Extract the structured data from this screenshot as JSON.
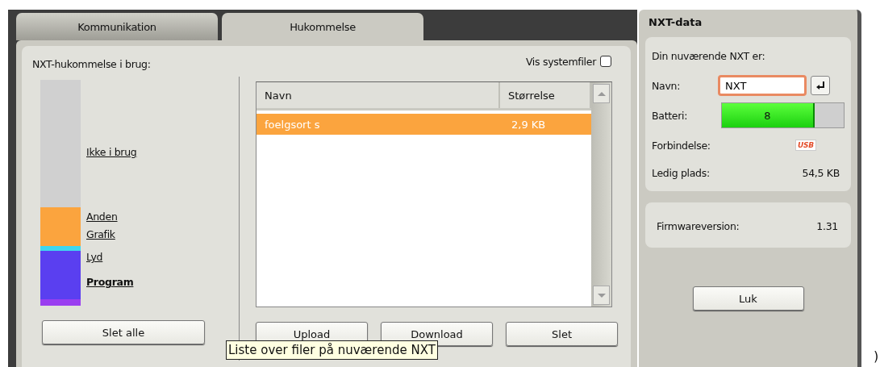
{
  "tabs": [
    {
      "label": "Kommunikation",
      "selected": false
    },
    {
      "label": "Hukommelse",
      "selected": true
    }
  ],
  "memory": {
    "title": "NXT-hukommelse i brug:",
    "segments": [
      {
        "label": "Ikke i brug",
        "color": "#d0d0d0",
        "selected": false
      },
      {
        "label": "Anden",
        "color": "#fba43e",
        "selected": false
      },
      {
        "label": "Grafik",
        "color": "#3fd6ee",
        "selected": false
      },
      {
        "label": "Lyd",
        "color": "#5a3ff0",
        "selected": false
      },
      {
        "label": "Program",
        "color": "#9a3ef0",
        "selected": true
      }
    ],
    "clear_button": "Slet alle"
  },
  "files": {
    "show_system": {
      "label": "Vis systemfiler",
      "checked": false
    },
    "columns": [
      "Navn",
      "Størrelse"
    ],
    "rows": [
      {
        "name": "foelgsort s",
        "size": "2,9 KB",
        "selected": true
      }
    ],
    "buttons": [
      "Upload",
      "Download",
      "Slet"
    ]
  },
  "tooltip": "Liste over filer på nuværende NXT",
  "nxt_data": {
    "title": "NXT-data",
    "intro": "Din nuværende NXT er:",
    "name_label": "Navn:",
    "name_value": "NXT",
    "battery_label": "Batteri:",
    "battery": {
      "level": 0.76,
      "reading": "8"
    },
    "connection_label": "Forbindelse:",
    "connection_badge": "USB",
    "free_label": "Ledig plads:",
    "free_value": "54,5 KB",
    "firmware_label": "Firmwareversion:",
    "firmware_value": "1.31",
    "close_button": "Luk"
  },
  "stray_text": ")"
}
